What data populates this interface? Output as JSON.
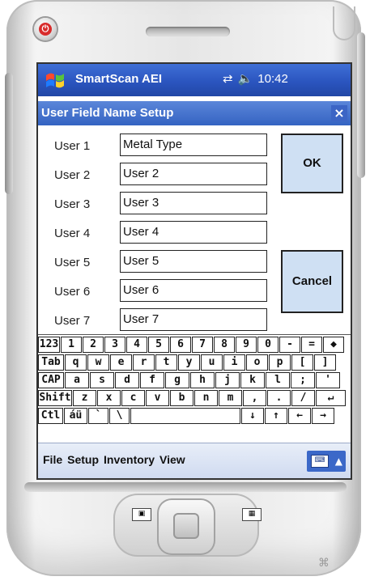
{
  "window": {
    "app_title": "SmartScan AEI",
    "time": "10:42"
  },
  "dialog": {
    "title": "User Field Name Setup",
    "close_label": "×"
  },
  "fields": [
    {
      "label": "User 1",
      "value": "Metal Type"
    },
    {
      "label": "User 2",
      "value": "User 2"
    },
    {
      "label": "User 3",
      "value": "User 3"
    },
    {
      "label": "User 4",
      "value": "User 4"
    },
    {
      "label": "User 5",
      "value": "User 5"
    },
    {
      "label": "User 6",
      "value": "User 6"
    },
    {
      "label": "User 7",
      "value": "User 7"
    }
  ],
  "buttons": {
    "ok": "OK",
    "cancel": "Cancel"
  },
  "keyboard": {
    "rows": [
      [
        "123",
        "1",
        "2",
        "3",
        "4",
        "5",
        "6",
        "7",
        "8",
        "9",
        "0",
        "-",
        "=",
        "◆"
      ],
      [
        "Tab",
        "q",
        "w",
        "e",
        "r",
        "t",
        "y",
        "u",
        "i",
        "o",
        "p",
        "[",
        "]"
      ],
      [
        "CAP",
        "a",
        "s",
        "d",
        "f",
        "g",
        "h",
        "j",
        "k",
        "l",
        ";",
        "'"
      ],
      [
        "Shift",
        "z",
        "x",
        "c",
        "v",
        "b",
        "n",
        "m",
        ",",
        ".",
        "/",
        "↵"
      ],
      [
        "Ctl",
        "áü",
        "`",
        "\\",
        "",
        "↓",
        "↑",
        "←",
        "→"
      ]
    ]
  },
  "menu": {
    "items": [
      "File",
      "Setup",
      "Inventory",
      "View"
    ]
  },
  "icons": {
    "windows_flag": "windows-flag-icon",
    "connectivity": "connectivity-icon",
    "volume": "volume-icon",
    "keyboard": "keyboard-icon",
    "power": "power-icon"
  }
}
